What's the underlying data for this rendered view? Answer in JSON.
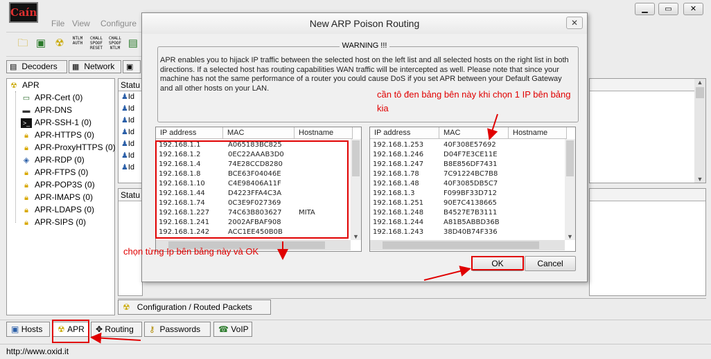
{
  "app": {
    "icon_text": "Caín"
  },
  "menu": [
    "File",
    "View",
    "Configure"
  ],
  "window_controls": {
    "minimize": "▁",
    "restore": "▭",
    "close": "✕"
  },
  "toolbar": {
    "labels": [
      "NTLM AUTH",
      "CHALL SPOOF RESET",
      "CHALL SPOOF NTLM"
    ]
  },
  "top_tabs": [
    {
      "label": "Decoders",
      "icon": "decoders-icon"
    },
    {
      "label": "Network",
      "icon": "network-icon"
    }
  ],
  "tree": {
    "root": "APR",
    "items": [
      {
        "label": "APR-Cert (0)",
        "icon": "certificate-icon"
      },
      {
        "label": "APR-DNS",
        "icon": "dns-icon"
      },
      {
        "label": "APR-SSH-1 (0)",
        "icon": "terminal-icon"
      },
      {
        "label": "APR-HTTPS (0)",
        "icon": "lock-icon"
      },
      {
        "label": "APR-ProxyHTTPS (0)",
        "icon": "lock-icon"
      },
      {
        "label": "APR-RDP (0)",
        "icon": "rdp-icon"
      },
      {
        "label": "APR-FTPS (0)",
        "icon": "lock-icon"
      },
      {
        "label": "APR-POP3S (0)",
        "icon": "lock-icon"
      },
      {
        "label": "APR-IMAPS (0)",
        "icon": "lock-icon"
      },
      {
        "label": "APR-LDAPS (0)",
        "icon": "lock-icon"
      },
      {
        "label": "APR-SIPS (0)",
        "icon": "lock-icon"
      }
    ]
  },
  "status_panes": {
    "top_header": "Statu",
    "bottom_header": "Statu",
    "rows": [
      "Id",
      "Id",
      "Id",
      "Id",
      "Id",
      "Id",
      "Id"
    ]
  },
  "dialog": {
    "title": "New ARP Poison Routing",
    "close": "✕",
    "warning_label": "WARNING !!!",
    "warning_text": "APR enables you to hijack IP traffic between the selected host on the left list and all selected hosts on the right list in both directions. If a selected host has routing capabilities WAN traffic will be intercepted as well. Please note that since your machine has not the same performance of a router you could cause DoS if you set APR between your Default Gateway and all other hosts on your LAN.",
    "columns": [
      "IP address",
      "MAC",
      "Hostname"
    ],
    "left_rows": [
      {
        "ip": "192.168.1.1",
        "mac": "A065183BC825",
        "host": ""
      },
      {
        "ip": "192.168.1.2",
        "mac": "0EC22AAAB3D0",
        "host": ""
      },
      {
        "ip": "192.168.1.4",
        "mac": "74E28CCD8280",
        "host": ""
      },
      {
        "ip": "192.168.1.8",
        "mac": "BCE63F04046E",
        "host": ""
      },
      {
        "ip": "192.168.1.10",
        "mac": "C4E98406A11F",
        "host": ""
      },
      {
        "ip": "192.168.1.44",
        "mac": "D4223FFA4C3A",
        "host": ""
      },
      {
        "ip": "192.168.1.74",
        "mac": "0C3E9F027369",
        "host": ""
      },
      {
        "ip": "192.168.1.227",
        "mac": "74C63B803627",
        "host": "MITA"
      },
      {
        "ip": "192.168.1.241",
        "mac": "2002AFBAF908",
        "host": ""
      },
      {
        "ip": "192.168.1.242",
        "mac": "ACC1EE450B0B",
        "host": ""
      }
    ],
    "right_rows": [
      {
        "ip": "192.168.1.253",
        "mac": "40F308E57692",
        "host": ""
      },
      {
        "ip": "192.168.1.246",
        "mac": "D04F7E3CE11E",
        "host": ""
      },
      {
        "ip": "192.168.1.247",
        "mac": "B8E856DF7431",
        "host": ""
      },
      {
        "ip": "192.168.1.78",
        "mac": "7C91224BC7B8",
        "host": ""
      },
      {
        "ip": "192.168.1.48",
        "mac": "40F3085DB5C7",
        "host": ""
      },
      {
        "ip": "192.168.1.3",
        "mac": "F099BF33D712",
        "host": ""
      },
      {
        "ip": "192.168.1.251",
        "mac": "90E7C4138665",
        "host": ""
      },
      {
        "ip": "192.168.1.248",
        "mac": "B4527E7B3111",
        "host": ""
      },
      {
        "ip": "192.168.1.244",
        "mac": "A81B5ABBD36B",
        "host": ""
      },
      {
        "ip": "192.168.1.243",
        "mac": "38D40B74F336",
        "host": ""
      }
    ],
    "ok_label": "OK",
    "cancel_label": "Cancel"
  },
  "annotations": {
    "right_note": "cần tô đen bảng bên này khi chọn 1 IP bên bảng kia",
    "left_note": "chọn từng Ip bên bảng này và OK",
    "color": "#e00000"
  },
  "config_tab": {
    "label": "Configuration / Routed Packets",
    "icon": "radiation-icon"
  },
  "bottom_tabs": [
    {
      "label": "Hosts",
      "icon": "hosts-icon"
    },
    {
      "label": "APR",
      "icon": "radiation-icon"
    },
    {
      "label": "Routing",
      "icon": "routing-icon"
    },
    {
      "label": "Passwords",
      "icon": "key-icon"
    },
    {
      "label": "VoIP",
      "icon": "voip-icon"
    }
  ],
  "status_bar": {
    "text": "http://www.oxid.it"
  }
}
